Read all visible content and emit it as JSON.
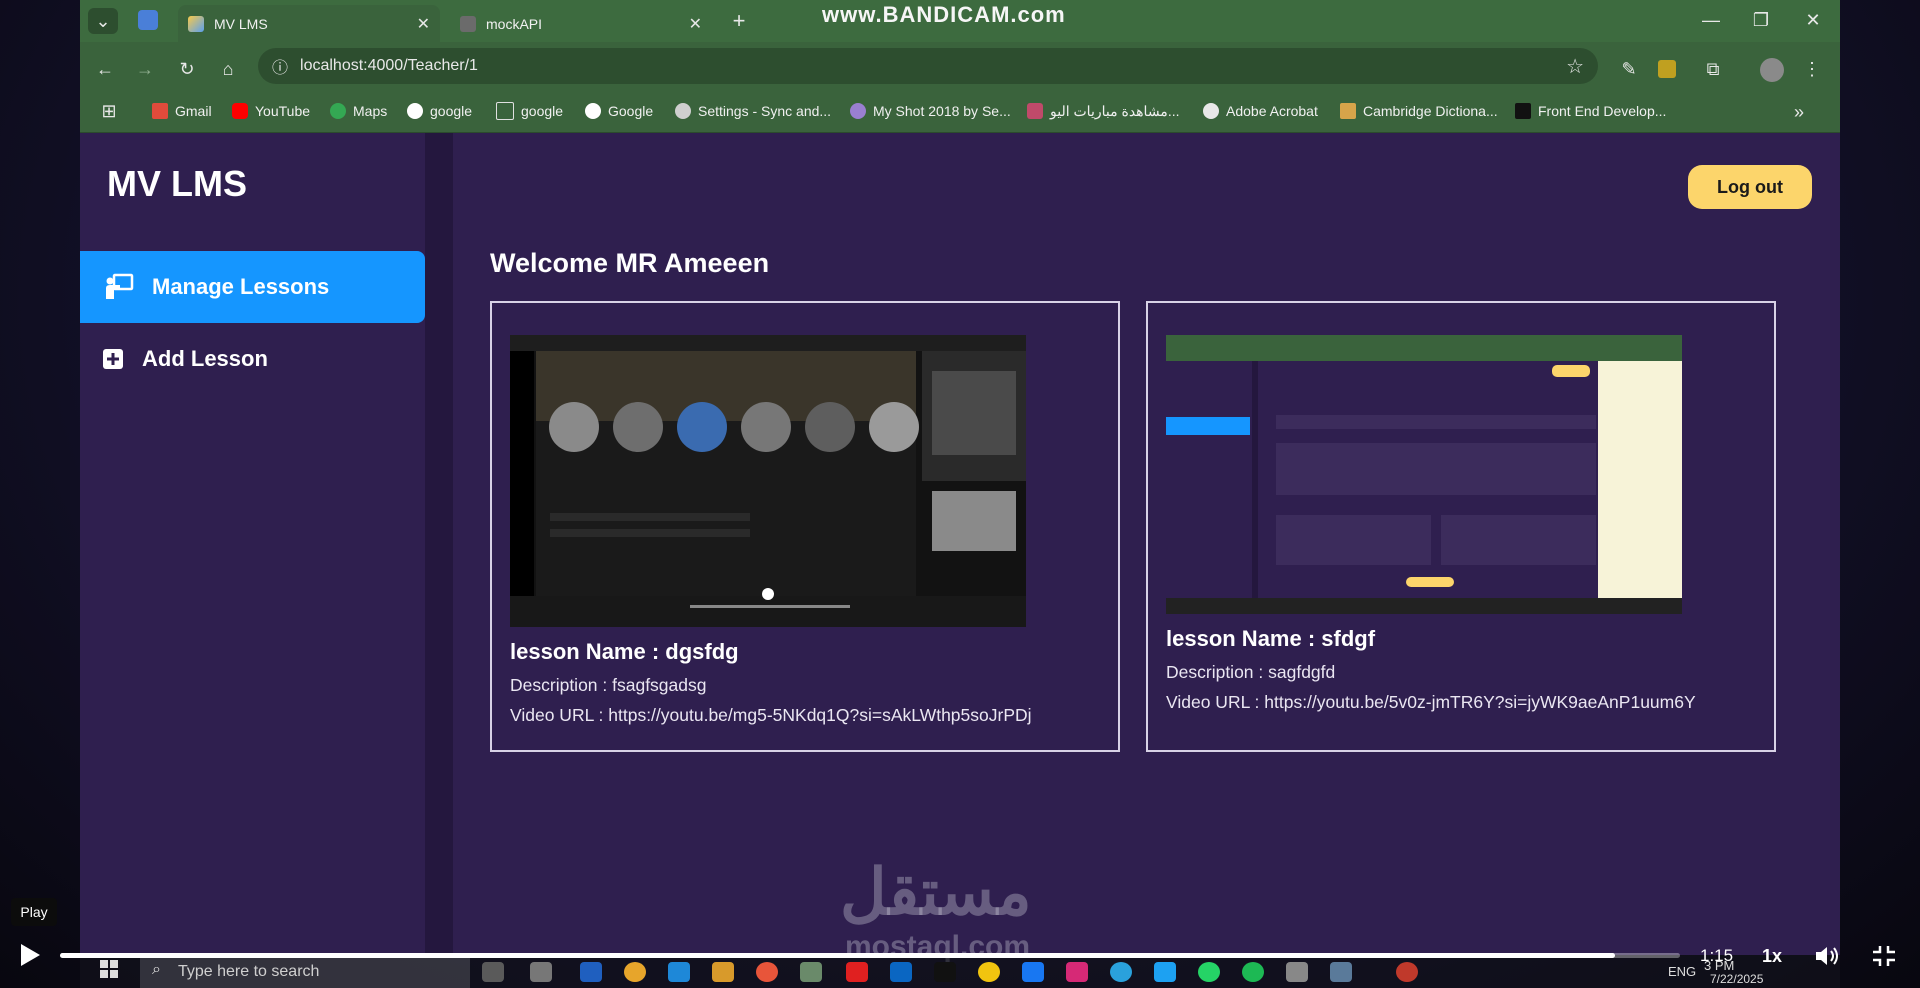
{
  "recorder_watermark": "www.BANDICAM.com",
  "browser": {
    "tabs": [
      {
        "label": "MV LMS",
        "active": true
      },
      {
        "label": "mockAPI",
        "active": false
      }
    ],
    "url": "localhost:4000/Teacher/1",
    "bookmarks": [
      "Gmail",
      "YouTube",
      "Maps",
      "google",
      "google",
      "Google",
      "Settings - Sync and...",
      "My Shot 2018 by Se...",
      "مشاهدة مباريات اليو...",
      "Adobe Acrobat",
      "Cambridge Dictiona...",
      "Front End Develop..."
    ]
  },
  "app": {
    "brand": "MV LMS",
    "nav": [
      {
        "label": "Manage Lessons",
        "icon": "teacher-icon",
        "active": true
      },
      {
        "label": "Add Lesson",
        "icon": "plus-square-icon",
        "active": false
      }
    ],
    "logout_label": "Log out",
    "welcome": "Welcome MR Ameeen",
    "lessons": [
      {
        "name": "lesson Name : dgsfdg",
        "description": "Description : fsagfsgadsg",
        "video_url": "Video URL : https://youtu.be/mg5-5NKdq1Q?si=sAkLWthp5soJrPDj"
      },
      {
        "name": "lesson Name : sfdgf",
        "description": "Description : sagfdgfd",
        "video_url": "Video URL : https://youtu.be/5v0z-jmTR6Y?si=jyWK9aeAnP1uum6Y"
      }
    ]
  },
  "player": {
    "tooltip": "Play",
    "time": "1:15",
    "speed": "1x",
    "progress_fraction": 0.96
  },
  "taskbar": {
    "search_placeholder": "Type here to search",
    "clock_time": "3 PM",
    "clock_date": "7/22/2025",
    "lang": "ENG"
  },
  "site_watermark": {
    "arabic": "مستقل",
    "latin": "mostaql.com"
  },
  "colors": {
    "accent": "#1596ff",
    "logout": "#fcd56b",
    "app_bg": "#2f1f4f"
  }
}
